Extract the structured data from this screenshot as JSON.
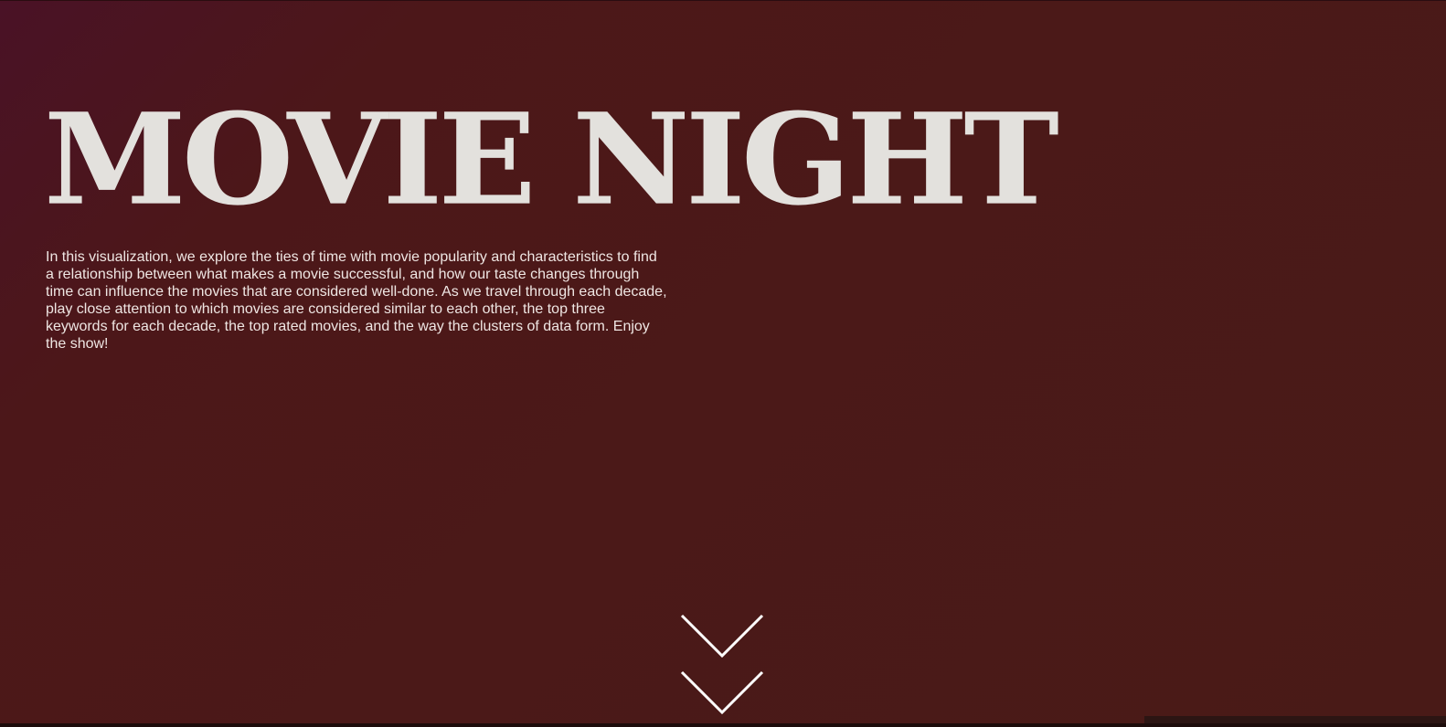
{
  "hero": {
    "title": "MOVIE NIGHT",
    "intro": "In this visualization, we explore the ties of time with movie popularity and characteristics to find a relationship between what makes a movie successful, and how our taste changes through time can influence the movies that are considered well-done. As we travel through each decade, play close attention to which movies are considered similar to each other, the top three keywords for each decade, the top rated movies, and the way the clusters of data form. Enjoy the show!"
  },
  "scroll_indicator": {
    "icon": "double-chevron-down-icon"
  },
  "colors": {
    "background": "#4b1918",
    "title_text": "#e3e1dd",
    "body_text": "#efe6e3",
    "chevron": "#ffffff"
  }
}
